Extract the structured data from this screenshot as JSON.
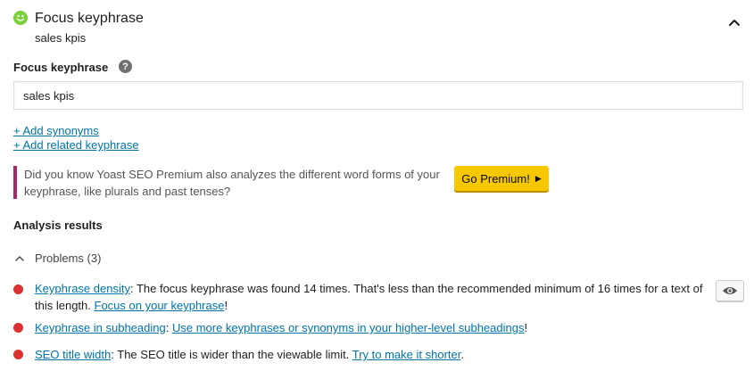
{
  "header": {
    "title": "Focus keyphrase",
    "subtitle": "sales kpis",
    "status_icon": "smiley-good-icon",
    "status_color": "#7ad03a"
  },
  "keyphrase": {
    "label": "Focus keyphrase",
    "help_glyph": "?",
    "value": "sales kpis"
  },
  "links": {
    "add_synonyms": "+ Add synonyms",
    "add_related": "+ Add related keyphrase"
  },
  "premium_notice": {
    "text": "Did you know Yoast SEO Premium also analyzes the different word forms of your keyphrase, like plurals and past tenses?",
    "button_label": "Go Premium!",
    "button_glyph": "▶",
    "accent_color": "#a4286a",
    "button_color": "#f7c800"
  },
  "analysis": {
    "title": "Analysis results",
    "problems_label": "Problems (3)",
    "problem_color": "#dc3232",
    "results": [
      {
        "link": "Keyphrase density",
        "text": ": The focus keyphrase was found 14 times. That's less than the recommended minimum of 16 times for a text of this length. ",
        "link2": "Focus on your keyphrase",
        "end": "!"
      },
      {
        "link": "Keyphrase in subheading",
        "text": ": ",
        "link2": "Use more keyphrases or synonyms in your higher-level subheadings",
        "end": "!"
      },
      {
        "link": "SEO title width",
        "text": ": The SEO title is wider than the viewable limit. ",
        "link2": "Try to make it shorter",
        "end": "."
      }
    ]
  }
}
